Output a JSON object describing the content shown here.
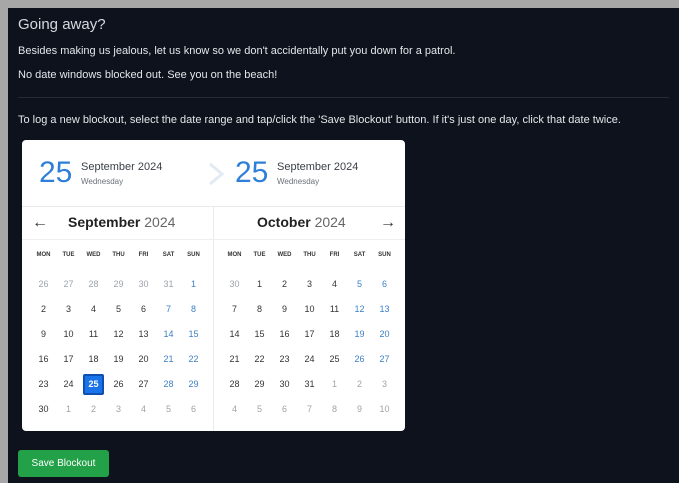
{
  "page": {
    "title": "Going away?",
    "line1": "Besides making us jealous, let us know so we don't accidentally put you down for a patrol.",
    "line2": "No date windows blocked out. See you on the beach!",
    "instructions": "To log a new blockout, select the date range and tap/click the 'Save Blockout' button. If it's just one day, click that date twice."
  },
  "range": {
    "start": {
      "day": "25",
      "month": "September 2024",
      "weekday": "Wednesday"
    },
    "end": {
      "day": "25",
      "month": "September 2024",
      "weekday": "Wednesday"
    }
  },
  "calendar": {
    "weekdays": [
      "MON",
      "TUE",
      "WED",
      "THU",
      "FRI",
      "SAT",
      "SUN"
    ],
    "left": {
      "month": "September",
      "year": "2024",
      "weeks": [
        [
          "26",
          "27",
          "28",
          "29",
          "30",
          "31",
          "1"
        ],
        [
          "2",
          "3",
          "4",
          "5",
          "6",
          "7",
          "8"
        ],
        [
          "9",
          "10",
          "11",
          "12",
          "13",
          "14",
          "15"
        ],
        [
          "16",
          "17",
          "18",
          "19",
          "20",
          "21",
          "22"
        ],
        [
          "23",
          "24",
          "25",
          "26",
          "27",
          "28",
          "29"
        ],
        [
          "30",
          "1",
          "2",
          "3",
          "4",
          "5",
          "6"
        ]
      ]
    },
    "right": {
      "month": "October",
      "year": "2024",
      "weeks": [
        [
          "30",
          "1",
          "2",
          "3",
          "4",
          "5",
          "6"
        ],
        [
          "7",
          "8",
          "9",
          "10",
          "11",
          "12",
          "13"
        ],
        [
          "14",
          "15",
          "16",
          "17",
          "18",
          "19",
          "20"
        ],
        [
          "21",
          "22",
          "23",
          "24",
          "25",
          "26",
          "27"
        ],
        [
          "28",
          "29",
          "30",
          "31",
          "1",
          "2",
          "3"
        ],
        [
          "4",
          "5",
          "6",
          "7",
          "8",
          "9",
          "10"
        ]
      ]
    },
    "selected_date": "2024-09-25"
  },
  "buttons": {
    "save": "Save Blockout"
  },
  "colors": {
    "accent": "#2f7fd8",
    "weekend": "#3d7fc6",
    "save": "#23a148"
  },
  "icons": {
    "prev": "←",
    "next": "→"
  }
}
